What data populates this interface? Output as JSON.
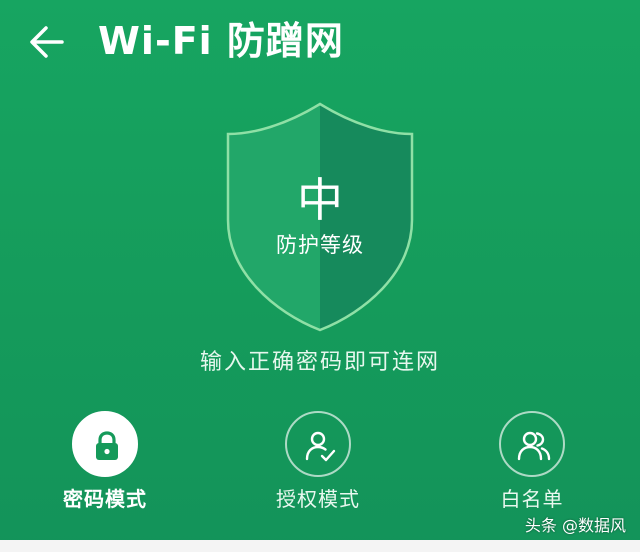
{
  "header": {
    "title": "Wi-Fi 防蹭网"
  },
  "shield": {
    "level": "中",
    "label": "防护等级"
  },
  "hint": "输入正确密码即可连网",
  "modes": [
    {
      "label": "密码模式",
      "icon": "lock-icon",
      "selected": true
    },
    {
      "label": "授权模式",
      "icon": "user-check-icon",
      "selected": false
    },
    {
      "label": "白名单",
      "icon": "users-icon",
      "selected": false
    }
  ],
  "watermark": "头条 @数据风",
  "colors": {
    "background": "#17a561",
    "shield_light": "#24a96b",
    "shield_dark": "#16895c",
    "shield_outline": "#8fe0a6",
    "active_circle": "#ffffff",
    "active_icon": "#159a5a"
  }
}
